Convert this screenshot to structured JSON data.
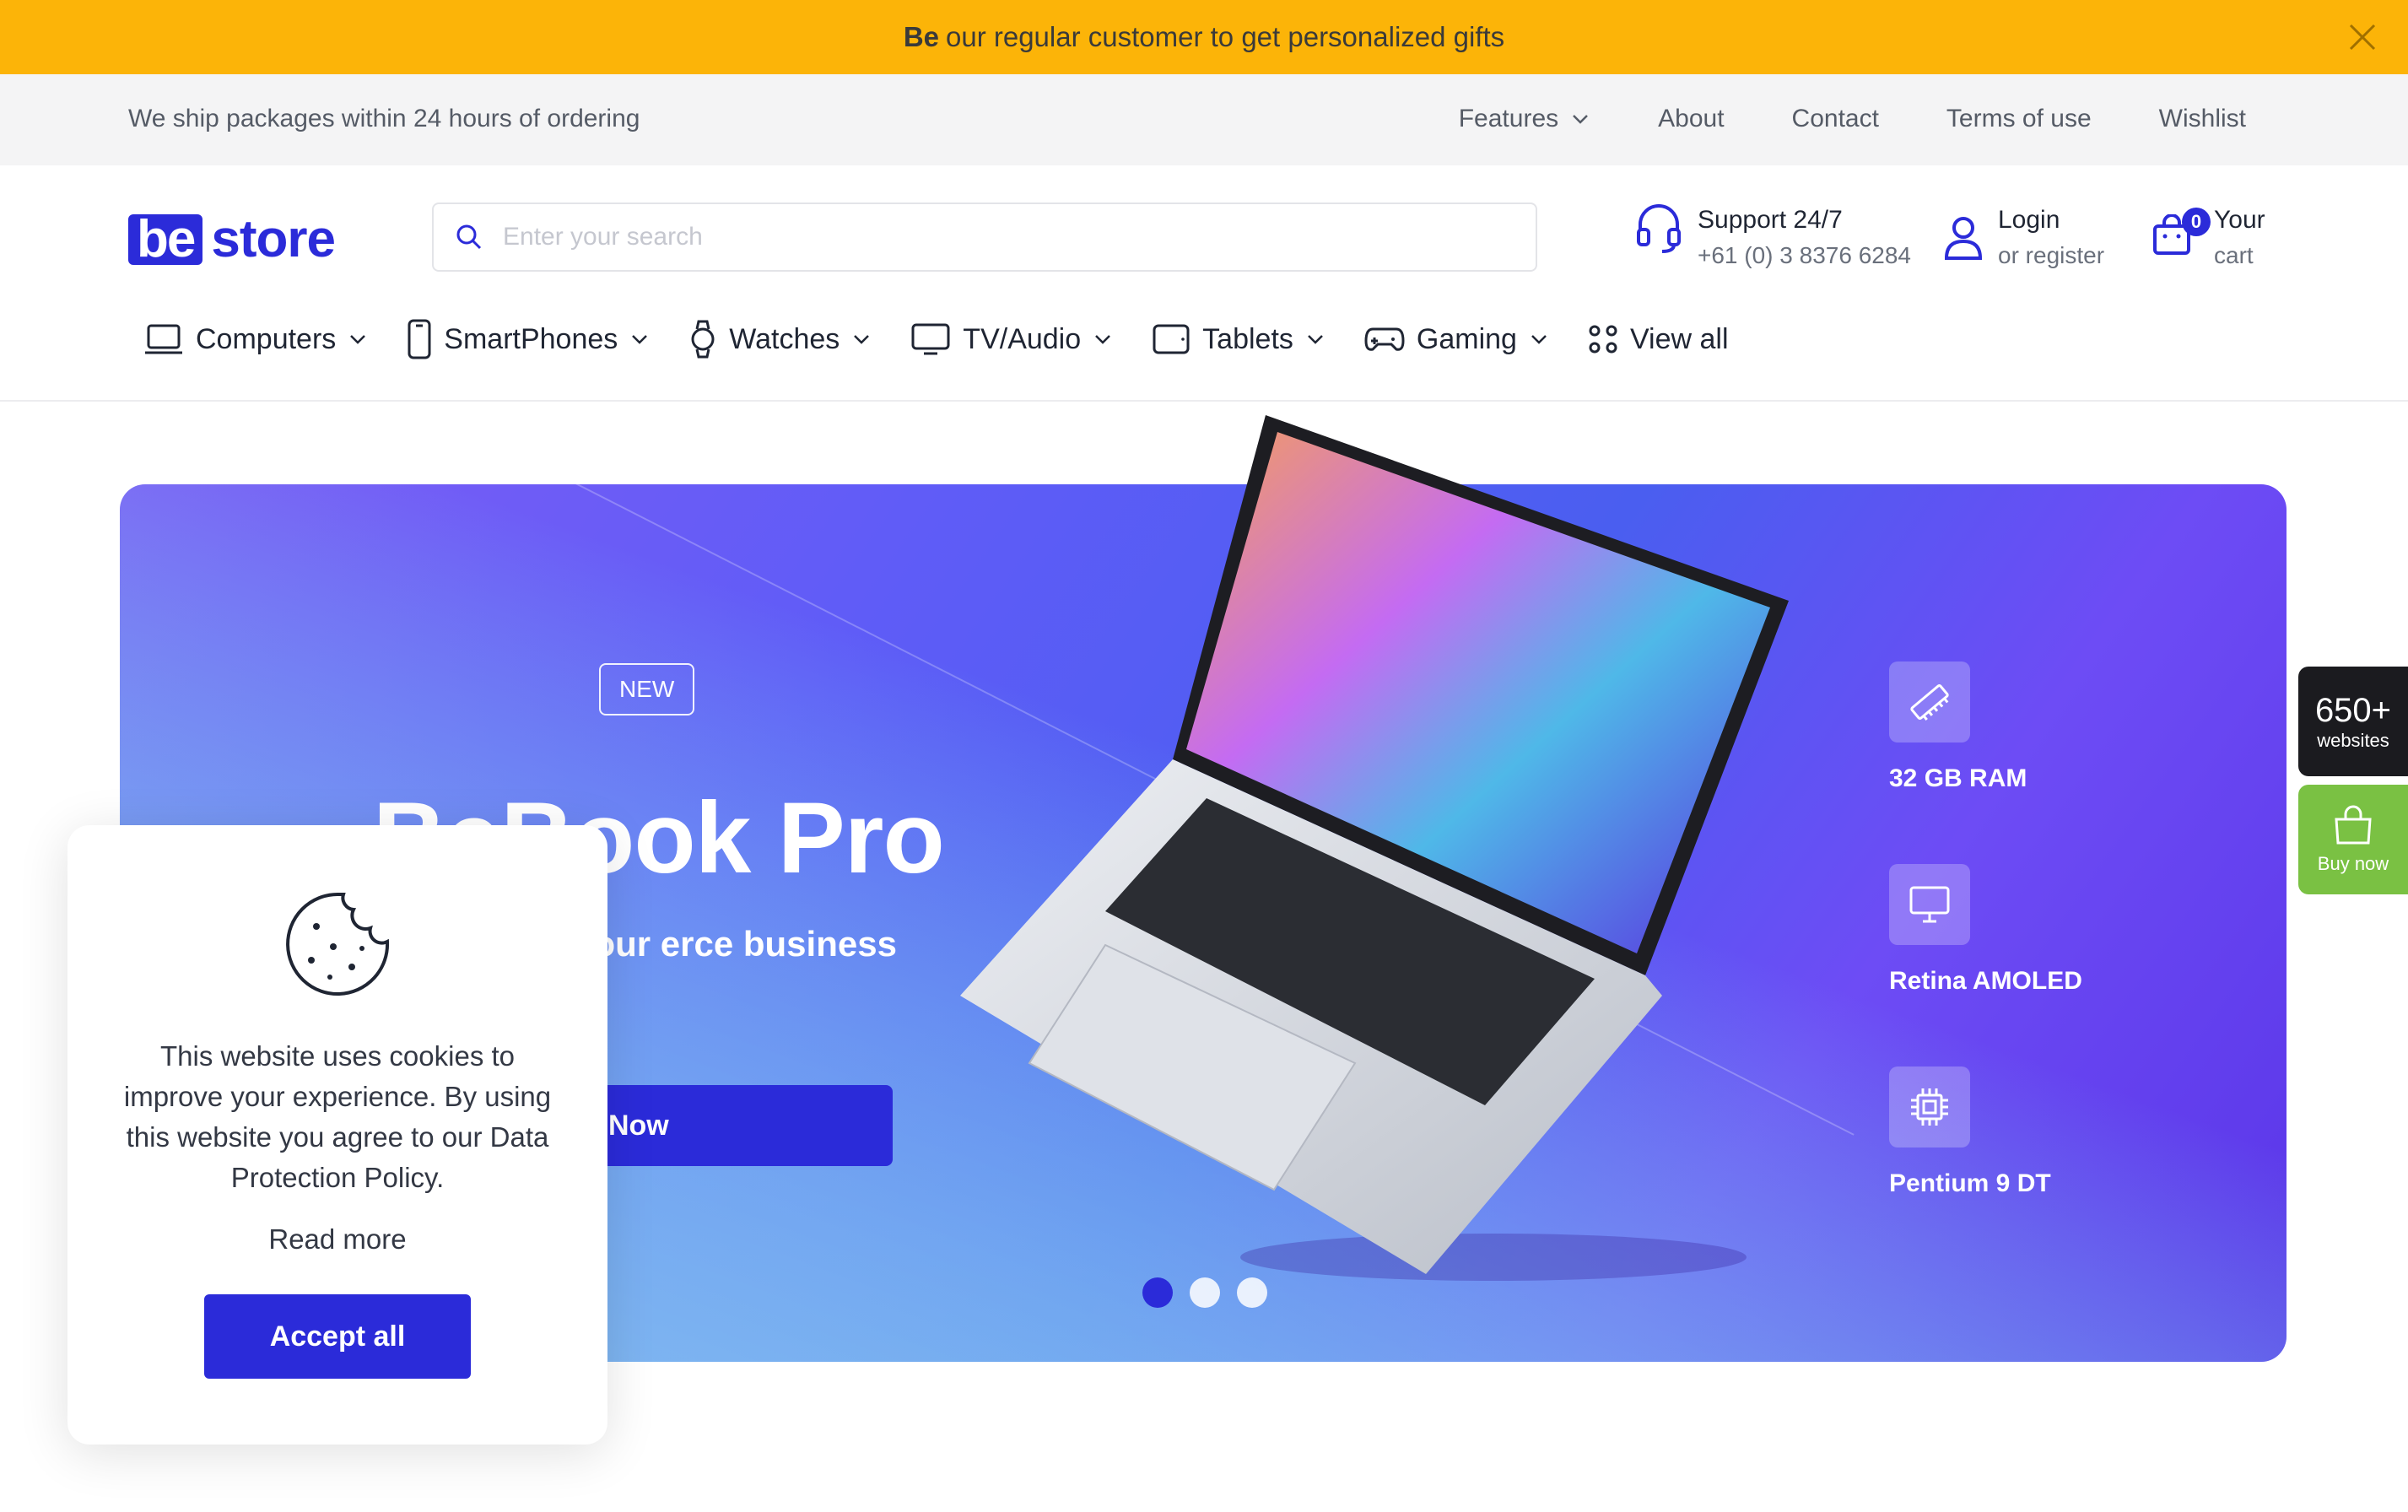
{
  "announcement": {
    "bold": "Be",
    "text": "our regular customer to get personalized gifts"
  },
  "topbar": {
    "ship_text": "We ship packages within 24 hours of ordering",
    "links": [
      "Features",
      "About",
      "Contact",
      "Terms of use",
      "Wishlist"
    ]
  },
  "logo": {
    "be": "be",
    "store": "store"
  },
  "search": {
    "placeholder": "Enter your search",
    "value": ""
  },
  "support": {
    "title": "Support 24/7",
    "phone": "+61 (0) 3 8376 6284"
  },
  "account": {
    "title": "Login",
    "sub": "or register"
  },
  "cart": {
    "count": "0",
    "title": "Your",
    "sub": "cart"
  },
  "categories": [
    "Computers",
    "SmartPhones",
    "Watches",
    "TV/Audio",
    "Tablets",
    "Gaming",
    "View all"
  ],
  "hero": {
    "badge": "NEW",
    "title": "BeBook Pro",
    "subtitle": "is ready for your erce business",
    "button": "Buy Now",
    "specs": [
      "32 GB RAM",
      "Retina AMOLED",
      "Pentium 9 DT"
    ],
    "slides": 3,
    "active_slide": 1
  },
  "side_widgets": {
    "count": "650+",
    "count_label": "websites",
    "buy_label": "Buy now"
  },
  "cookie": {
    "text": "This website uses cookies to improve your experience. By using this website you agree to our Data Protection Policy.",
    "read_more": "Read more",
    "accept": "Accept all"
  },
  "colors": {
    "announce_bg": "#fcb408",
    "brand": "#2b2bd9",
    "buy_green": "#7ac143"
  }
}
